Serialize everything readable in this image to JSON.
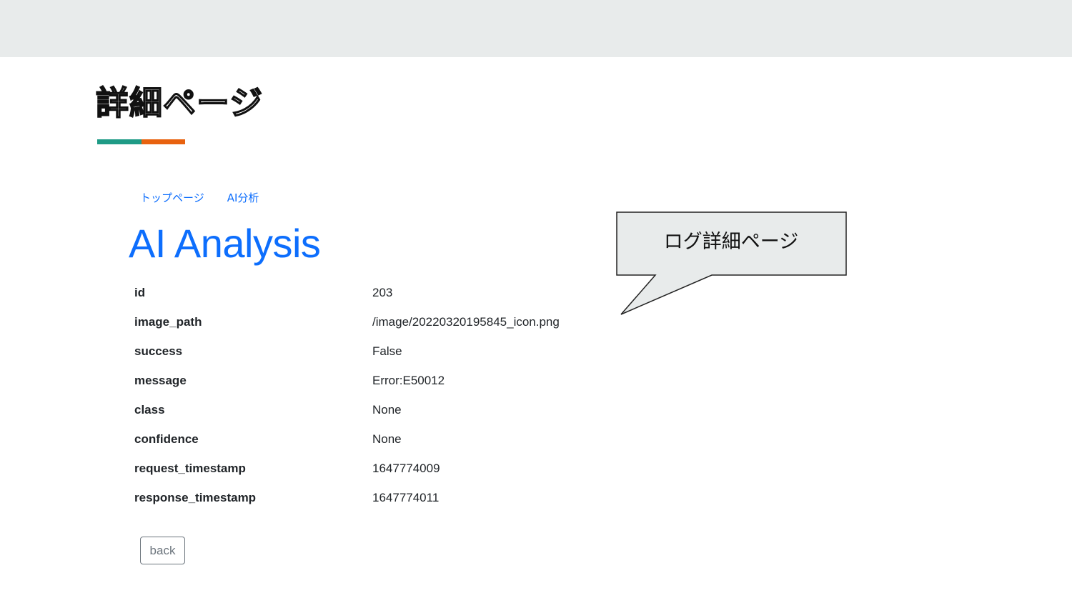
{
  "slide": {
    "title": "詳細ページ",
    "underline_colors": [
      "#1f9b86",
      "#e8620f"
    ]
  },
  "nav": {
    "items": [
      {
        "label": "トップページ"
      },
      {
        "label": "AI分析"
      }
    ]
  },
  "page": {
    "heading": "AI Analysis"
  },
  "details": [
    {
      "key": "id",
      "value": "203"
    },
    {
      "key": "image_path",
      "value": "/image/20220320195845_icon.png"
    },
    {
      "key": "success",
      "value": "False"
    },
    {
      "key": "message",
      "value": "Error:E50012"
    },
    {
      "key": "class",
      "value": "None"
    },
    {
      "key": "confidence",
      "value": "None"
    },
    {
      "key": "request_timestamp",
      "value": "1647774009"
    },
    {
      "key": "response_timestamp",
      "value": "1647774011"
    }
  ],
  "back_button": {
    "label": "back"
  },
  "callout": {
    "text": "ログ詳細ページ"
  },
  "colors": {
    "link": "#0d6efd",
    "top_band": "#e8ebeb",
    "callout_fill": "#e8ebeb"
  }
}
